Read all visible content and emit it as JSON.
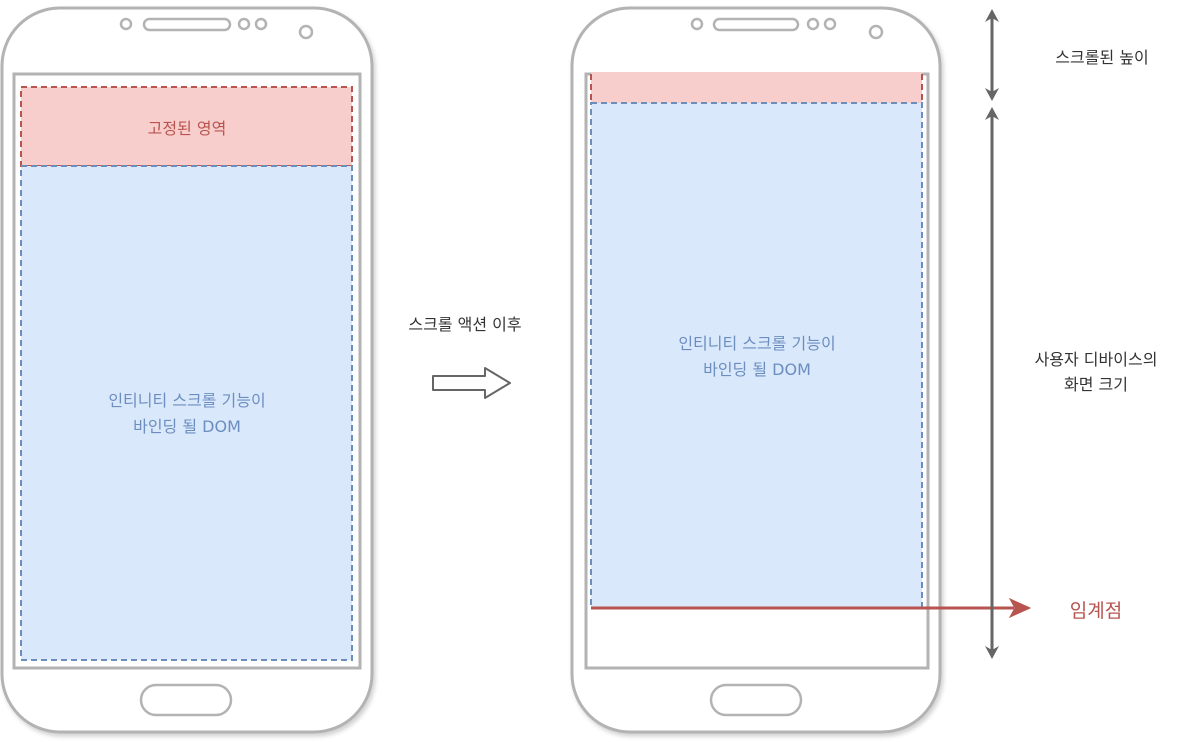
{
  "left_phone": {
    "fixed_area_label": "고정된 영역",
    "dom_label_line1": "인티니티 스크롤 기능이",
    "dom_label_line2": "바인딩 될 DOM"
  },
  "transition": {
    "label": "스크롤 액션 이후"
  },
  "right_phone": {
    "dom_label_line1": "인티니티 스크롤 기능이",
    "dom_label_line2": "바인딩 될 DOM"
  },
  "annotations": {
    "scrolled_height": "스크롤된 높이",
    "screen_size_line1": "사용자 디바이스의",
    "screen_size_line2": "화면 크기",
    "threshold": "임계점"
  },
  "colors": {
    "fixed_fill": "#f8cecc",
    "fixed_stroke": "#b85450",
    "dom_fill": "#dae8fc",
    "dom_stroke": "#6c8ebf",
    "phone_stroke": "#b3b3b3",
    "threshold": "#b85450",
    "dom_text": "#6c8ebf",
    "fixed_text": "#b85450",
    "dark_text": "#333333"
  }
}
